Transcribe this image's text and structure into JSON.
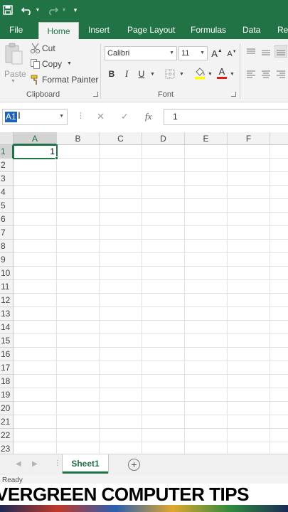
{
  "app": {
    "accent": "#217346"
  },
  "quick_access": [
    {
      "name": "save-icon",
      "glyph": "💾"
    },
    {
      "name": "undo-icon",
      "glyph": "↶"
    },
    {
      "name": "redo-icon",
      "glyph": "↷"
    },
    {
      "name": "customize-qat-icon",
      "glyph": "▾"
    }
  ],
  "tabs": [
    {
      "label": "File",
      "active": false
    },
    {
      "label": "Home",
      "active": true
    },
    {
      "label": "Insert",
      "active": false
    },
    {
      "label": "Page Layout",
      "active": false
    },
    {
      "label": "Formulas",
      "active": false
    },
    {
      "label": "Data",
      "active": false
    },
    {
      "label": "Re",
      "active": false
    }
  ],
  "ribbon": {
    "clipboard": {
      "paste_label": "Paste",
      "cut_label": "Cut",
      "copy_label": "Copy",
      "format_painter_label": "Format Painter",
      "group_label": "Clipboard"
    },
    "font": {
      "font_name": "Calibri",
      "font_size": "11",
      "bold": "B",
      "italic": "I",
      "underline": "U",
      "grow": "A",
      "shrink": "A",
      "font_color_letter": "A",
      "group_label": "Font"
    }
  },
  "formula_bar": {
    "name_box": "A1",
    "cancel_icon": "✕",
    "enter_icon": "✓",
    "fx_icon": "fx",
    "value": "1"
  },
  "sheet": {
    "columns": [
      "A",
      "B",
      "C",
      "D",
      "E",
      "F"
    ],
    "rows": [
      "1",
      "2",
      "3",
      "4",
      "5",
      "6",
      "7",
      "8",
      "9",
      "10",
      "11",
      "12",
      "13",
      "14",
      "15",
      "16",
      "17",
      "18",
      "19",
      "20",
      "21",
      "22",
      "23"
    ],
    "active_cell": {
      "col": "A",
      "row": "1"
    },
    "cells": [
      {
        "col": "A",
        "row": "1",
        "value": "1"
      }
    ]
  },
  "sheet_tabs": [
    {
      "label": "Sheet1",
      "active": true
    }
  ],
  "status": {
    "text": "Ready"
  },
  "banner": {
    "text": "VERGREEN COMPUTER TIPS"
  }
}
